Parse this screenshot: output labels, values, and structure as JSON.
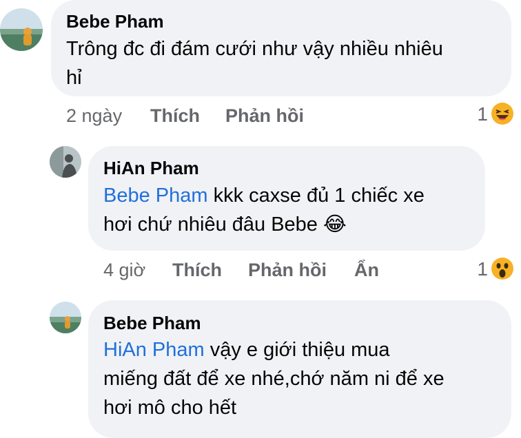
{
  "comments": [
    {
      "author": "Bebe Pham",
      "mention": "",
      "text_lines": [
        "Trông đc đi đám cưới như vậy nhiều nhiêu",
        "hỉ"
      ],
      "time": "2 ngày",
      "like_label": "Thích",
      "reply_label": "Phản hồi",
      "hide_label": "",
      "reaction_count": "1",
      "reaction_icon": "laughing-emoji-icon"
    },
    {
      "author": "HiAn Pham",
      "mention": "Bebe Pham",
      "text_lines": [
        " kkk caxse đủ 1 chiếc xe",
        "hơi chứ nhiêu đâu Bebe 😂"
      ],
      "time": "4 giờ",
      "like_label": "Thích",
      "reply_label": "Phản hồi",
      "hide_label": "Ẩn",
      "reaction_count": "1",
      "reaction_icon": "wow-emoji-icon"
    },
    {
      "author": "Bebe Pham",
      "mention": "HiAn Pham",
      "text_lines": [
        " vậy e giới thiệu mua",
        "miếng đất để xe nhé,chớ năm ni để xe",
        "hơi mô cho hết"
      ],
      "time": "",
      "like_label": "",
      "reply_label": "",
      "hide_label": "",
      "reaction_count": "",
      "reaction_icon": ""
    }
  ],
  "colors": {
    "bubble": "#f0f2f5",
    "mention": "#216fdb",
    "meta": "#65676b",
    "emoji": "#f7b125"
  }
}
